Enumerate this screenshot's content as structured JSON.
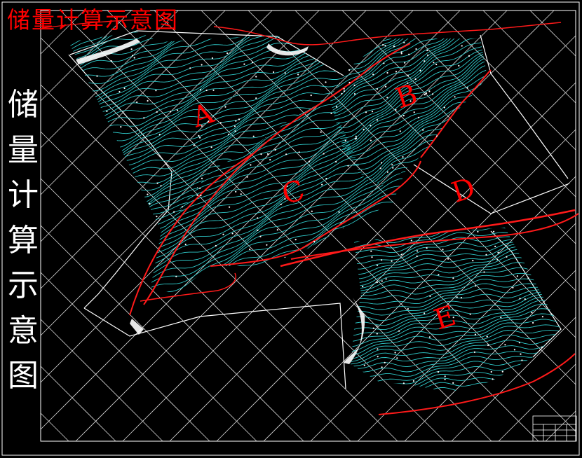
{
  "header": {
    "title": "储量计算示意图"
  },
  "side_title": {
    "chars": [
      "储",
      "量",
      "计",
      "算",
      "示",
      "意",
      "图"
    ]
  },
  "zones": [
    {
      "id": "A",
      "label": "A"
    },
    {
      "id": "B",
      "label": "B"
    },
    {
      "id": "C",
      "label": "C"
    },
    {
      "id": "D",
      "label": "D"
    },
    {
      "id": "E",
      "label": "E"
    }
  ],
  "colors": {
    "background": "#000000",
    "contour": "#2ec8c8",
    "boundary_red": "#ff1a1a",
    "grid_white": "#ffffff",
    "title_red": "#ff0000"
  }
}
